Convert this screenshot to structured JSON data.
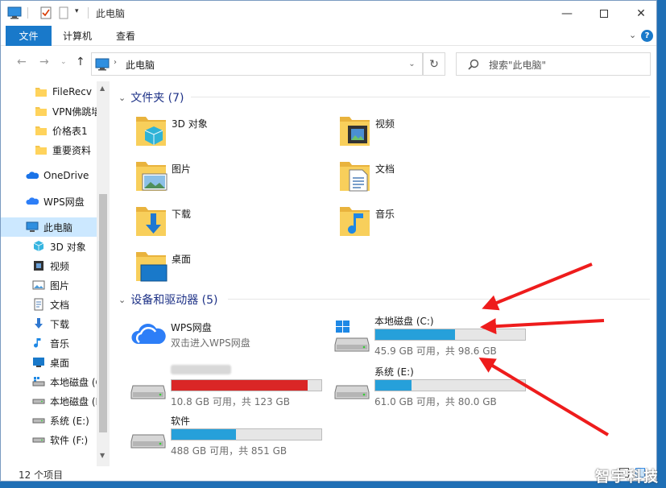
{
  "window": {
    "title": "此电脑"
  },
  "ribbon": {
    "file_tab": "文件",
    "tabs": [
      "计算机",
      "查看"
    ]
  },
  "address": {
    "path": "此电脑",
    "search_placeholder": "搜索\"此电脑\""
  },
  "sidebar": {
    "items": [
      {
        "label": "FileRecv",
        "icon": "folder-icon"
      },
      {
        "label": "VPN佛跳墙",
        "icon": "folder-icon"
      },
      {
        "label": "价格表1",
        "icon": "folder-icon"
      },
      {
        "label": "重要资料",
        "icon": "folder-icon"
      },
      {
        "label": "OneDrive",
        "icon": "onedrive-icon"
      },
      {
        "label": "WPS网盘",
        "icon": "wps-cloud-icon"
      },
      {
        "label": "此电脑",
        "icon": "computer-icon"
      },
      {
        "label": "3D 对象",
        "icon": "3d-objects-icon"
      },
      {
        "label": "视频",
        "icon": "video-icon"
      },
      {
        "label": "图片",
        "icon": "pictures-icon"
      },
      {
        "label": "文档",
        "icon": "documents-icon"
      },
      {
        "label": "下载",
        "icon": "download-icon"
      },
      {
        "label": "音乐",
        "icon": "music-icon"
      },
      {
        "label": "桌面",
        "icon": "desktop-icon"
      },
      {
        "label": "本地磁盘 (C:)",
        "icon": "drive-c-icon"
      },
      {
        "label": "本地磁盘 (D:)",
        "icon": "drive-icon"
      },
      {
        "label": "系统 (E:)",
        "icon": "drive-icon"
      },
      {
        "label": "软件 (F:)",
        "icon": "drive-icon"
      }
    ]
  },
  "folders_section": {
    "title": "文件夹 (7)",
    "items": [
      {
        "label": "3D 对象",
        "icon": "3d-objects-folder-icon"
      },
      {
        "label": "视频",
        "icon": "video-folder-icon"
      },
      {
        "label": "图片",
        "icon": "pictures-folder-icon"
      },
      {
        "label": "文档",
        "icon": "documents-folder-icon"
      },
      {
        "label": "下载",
        "icon": "download-folder-icon"
      },
      {
        "label": "音乐",
        "icon": "music-folder-icon"
      },
      {
        "label": "桌面",
        "icon": "desktop-folder-icon"
      }
    ]
  },
  "drives_section": {
    "title": "设备和驱动器 (5)",
    "wps": {
      "name": "WPS网盘",
      "subtitle": "双击进入WPS网盘"
    },
    "drives": [
      {
        "name": "本地磁盘 (C:)",
        "usage": 0.53,
        "status": "45.9 GB 可用，共 98.6 GB",
        "color": "#26a0da"
      },
      {
        "name": "",
        "usage": 0.91,
        "status": "10.8 GB 可用，共 123 GB",
        "color": "#da2626"
      },
      {
        "name": "系统 (E:)",
        "usage": 0.24,
        "status": "61.0 GB 可用，共 80.0 GB",
        "color": "#26a0da"
      },
      {
        "name": "软件",
        "usage": 0.43,
        "status": "488 GB 可用，共 851 GB",
        "color": "#26a0da"
      }
    ]
  },
  "status": {
    "count": "12 个项目"
  },
  "watermark": "智宇科技"
}
